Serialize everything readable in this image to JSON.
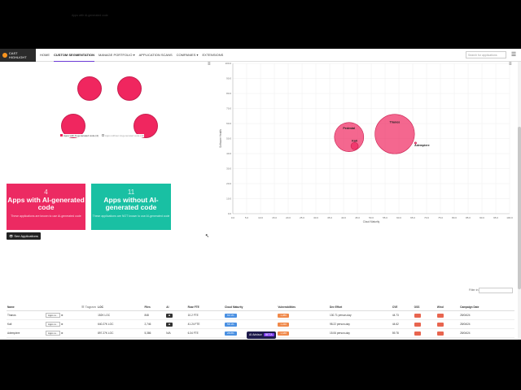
{
  "nav": {
    "logo_text": "CAST HIGHLIGHT",
    "items": [
      {
        "label": "HOME",
        "active": false
      },
      {
        "label": "CUSTOM SEGMENTATION",
        "active": true
      },
      {
        "label": "MANAGE PORTFOLIO ▾",
        "active": false
      },
      {
        "label": "APPLICATION SCANS",
        "active": false
      },
      {
        "label": "COMPANIES ▾",
        "active": false
      },
      {
        "label": "EXTENSIONS",
        "active": false
      }
    ],
    "search_placeholder": "Search for applications"
  },
  "pie_panel": {
    "label": "Apps with AI-generated code",
    "legend": [
      "Apps with AI-generated code (4)",
      "Apps without AI-generated code (11)"
    ]
  },
  "bubble_chart": {
    "ylabel": "Software Health",
    "xlabel": "Cloud Maturity",
    "y_ticks": [
      "100.0",
      "90.0",
      "80.0",
      "70.0",
      "60.0",
      "50.0",
      "40.0",
      "30.0",
      "20.0",
      "10.0",
      "0.0"
    ],
    "x_ticks": [
      "0.0",
      "5.0",
      "10.0",
      "15.0",
      "20.0",
      "25.0",
      "30.0",
      "35.0",
      "40.0",
      "45.0",
      "50.0",
      "55.0",
      "60.0",
      "65.0",
      "70.0",
      "75.0",
      "80.0",
      "85.0",
      "90.0",
      "95.0",
      "100.0"
    ]
  },
  "chart_data": {
    "type": "scatter",
    "xlabel": "Cloud Maturity",
    "ylabel": "Software Health",
    "xlim": [
      0,
      100
    ],
    "ylim": [
      0,
      100
    ],
    "series": [
      {
        "points": [
          {
            "label": "Pedestal",
            "x": 42,
            "y": 51,
            "size": 1.0
          },
          {
            "label": "Thanos",
            "x": 58.5,
            "y": 53,
            "size": 1.35
          },
          {
            "label": "Kali",
            "x": 44,
            "y": 45,
            "size": 0.25
          },
          {
            "label": "Adempiere",
            "x": 66,
            "y": 47,
            "size": 0.05
          }
        ]
      }
    ]
  },
  "cards": [
    {
      "num": "4",
      "title": "Apps with AI-generated code",
      "desc": "These applications are known to use AI-generated code",
      "color": "#ec2a62"
    },
    {
      "num": "11",
      "title": "Apps without AI-generated code",
      "desc": "These applications are NOT known to use AI-generated code",
      "color": "#19c0a3"
    }
  ],
  "see_apps_label": "See Applications",
  "filter_label": "Filter in:",
  "tagram_label": "Tagram",
  "table": {
    "headers": [
      "Name",
      "",
      "",
      "LOC",
      "Files",
      "AI",
      "Roar FTE",
      "Cloud Maturity",
      "Vulnerabilities",
      "Dev Effort",
      "CVE",
      "OSS",
      "Wind",
      "Campaign Date"
    ],
    "rows": [
      [
        "Thanos",
        "Apps w...",
        "152K LOC",
        "848",
        "",
        "10.2 FTE",
        "60.1%",
        "1,286",
        "130.71 person-day",
        "44.73",
        "",
        "",
        "",
        "28/04/24"
      ],
      [
        "Kali",
        "Apps w...",
        "640.27K LOC",
        "2,746",
        "",
        "41.24 FTE",
        "58.1%",
        "1,240",
        "98.22 person-day",
        "44.62",
        "",
        "",
        "",
        "28/04/24"
      ],
      [
        "Adempiere",
        "Apps w...",
        "897.27K LOC",
        "5,386",
        "N/A",
        "6.34 FTE",
        "28.8%",
        "1,188",
        "15.06 person-day",
        "59.78",
        "",
        "",
        "",
        "28/04/24"
      ]
    ]
  },
  "ai_badge": {
    "label": "AI Advisor",
    "badge": "BETA"
  }
}
